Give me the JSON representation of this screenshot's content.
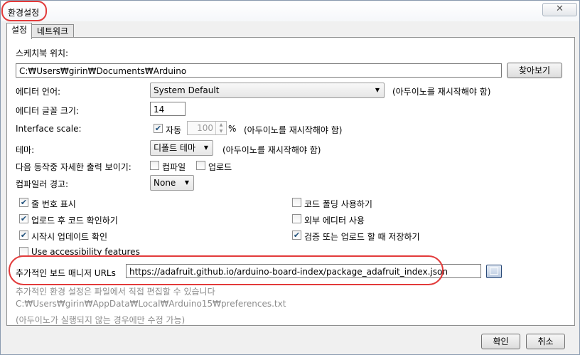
{
  "window": {
    "title": "환경설정",
    "close_glyph": "✕"
  },
  "tabs": [
    {
      "label": "설정"
    },
    {
      "label": "네트워크"
    }
  ],
  "sketchbook": {
    "label": "스케치북 위치:",
    "path": "C:₩Users₩girin₩Documents₩Arduino",
    "browse_label": "찾아보기"
  },
  "editor_language": {
    "label": "에디터 언어:",
    "value": "System Default",
    "note": "(아두이노를 재시작해야 함)"
  },
  "editor_font": {
    "label": "에디터 글꼴 크기:",
    "value": "14"
  },
  "interface_scale": {
    "label": "Interface scale:",
    "auto_label": "자동",
    "auto_checked": true,
    "value": "100",
    "unit": "%",
    "note": "(아두이노를 재시작해야 함)"
  },
  "theme": {
    "label": "테마:",
    "value": "디폴트 테마",
    "note": "(아두이노를 재시작해야 함)"
  },
  "verbose": {
    "label": "다음 동작중 자세한  출력 보이기:",
    "compile_label": "컴파일",
    "compile_checked": false,
    "upload_label": "업로드",
    "upload_checked": false
  },
  "compiler_warnings": {
    "label": "컴파일러 경고:",
    "value": "None"
  },
  "options_left": [
    {
      "label": "줄 번호 표시",
      "checked": true
    },
    {
      "label": "업로드 후 코드 확인하기",
      "checked": true
    },
    {
      "label": "시작시 업데이트 확인",
      "checked": true
    },
    {
      "label": "Use accessibility features",
      "checked": false
    }
  ],
  "options_right": [
    {
      "label": "코드 폴딩 사용하기",
      "checked": false
    },
    {
      "label": "외부 에디터 사용",
      "checked": false
    },
    {
      "label": "검증 또는 업로드 할 때 저장하기",
      "checked": true
    }
  ],
  "board_urls": {
    "label": "추가적인 보드 매니저 URLs",
    "value": "https://adafruit.github.io/arduino-board-index/package_adafruit_index.json"
  },
  "footer_notes": {
    "line1": "추가적인 환경 설정은 파일에서 직접 편집할 수 있습니다",
    "line2": "C:₩Users₩girin₩AppData₩Local₩Arduino15₩preferences.txt",
    "line3": "(아두이노가 실행되지 않는 경우에만 수정 가능)"
  },
  "buttons": {
    "ok": "확인",
    "cancel": "취소"
  },
  "colors": {
    "highlight_circle": "#e23a3a",
    "checkmark": "#21527d"
  }
}
